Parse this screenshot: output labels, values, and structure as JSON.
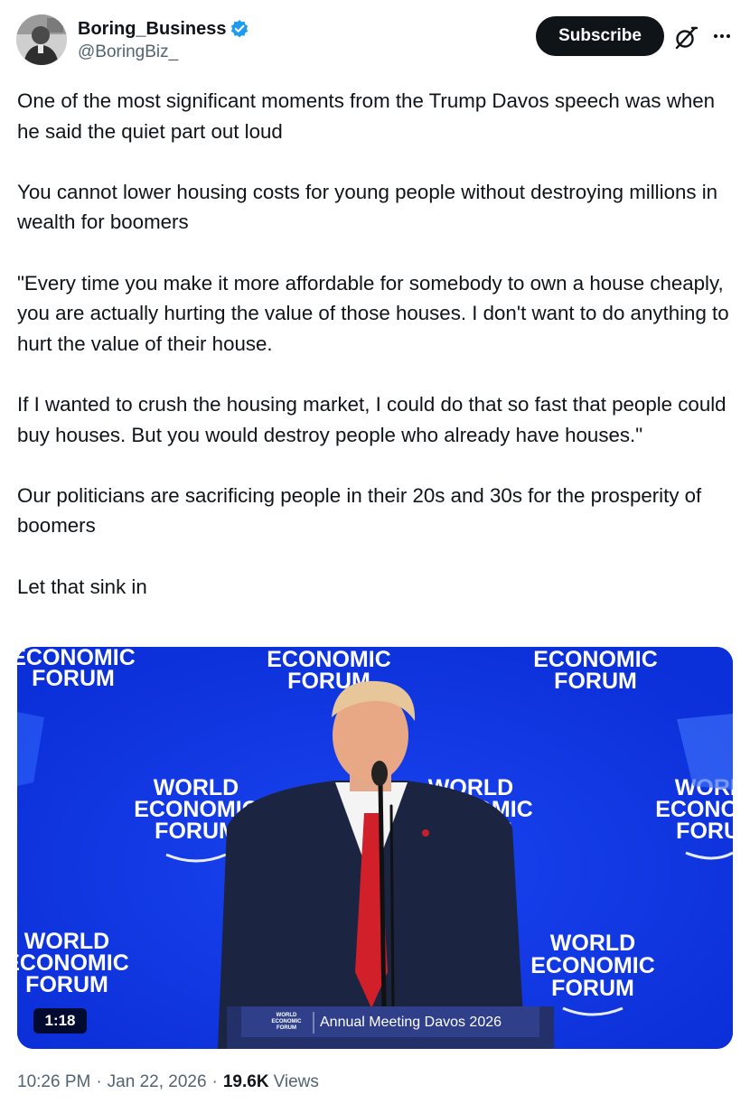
{
  "author": {
    "display_name": "Boring_Business",
    "handle": "@BoringBiz_",
    "verified": true,
    "verified_color": "#1d9bf0"
  },
  "actions": {
    "subscribe_label": "Subscribe",
    "grok_icon": "grok-icon",
    "more_icon": "more-icon"
  },
  "tweet": {
    "paragraphs": [
      "One of the most significant moments from the Trump Davos speech was when he said the quiet part out loud",
      "You cannot lower housing costs for young people without destroying millions in wealth for boomers",
      "\"Every time you make it more affordable for somebody to own a house cheaply, you are actually hurting the value of those houses. I don't want to do anything to hurt the value of their house.",
      "If I wanted to crush the housing market, I could do that so fast that people could buy houses. But you would destroy people who already have houses.\"",
      "Our politicians are sacrificing people in their 20s and 30s for the prosperity of boomers",
      "Let that sink in"
    ]
  },
  "media": {
    "duration": "1:18",
    "backdrop_logo_lines": [
      "WORLD",
      "ECONOMIC",
      "FORUM"
    ],
    "podium_logo_lines": [
      "WORLD",
      "ECONOMIC",
      "FORUM"
    ],
    "podium_text": "Annual Meeting Davos 2026",
    "backdrop_color": "#1136e6"
  },
  "meta": {
    "time": "10:26 PM",
    "date": "Jan 22, 2026",
    "separator": "·",
    "views_count": "19.6K",
    "views_label": "Views"
  }
}
